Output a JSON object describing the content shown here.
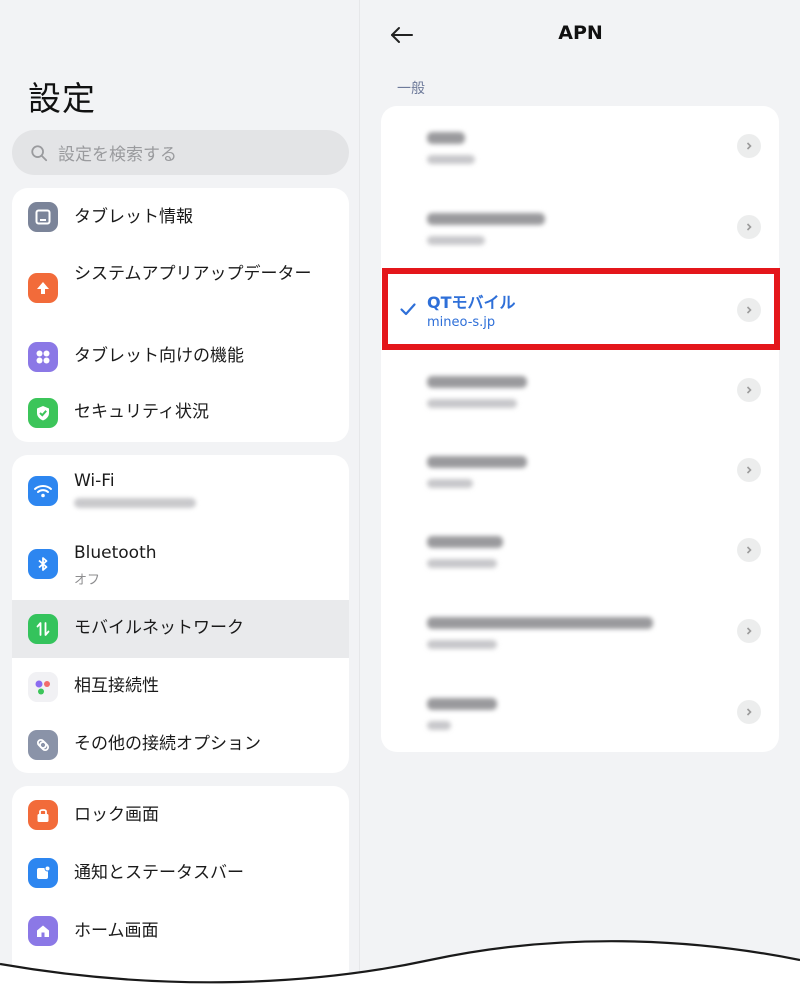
{
  "settings": {
    "title": "設定",
    "search_placeholder": "設定を検索する",
    "groups": [
      {
        "items": [
          {
            "label": "タブレット情報",
            "icon": "tablet-icon",
            "color": "#7b8499"
          },
          {
            "label": "システムアプリアップデーター",
            "icon": "arrow-up-icon",
            "color": "#f26b3a"
          },
          {
            "label": "タブレット向けの機能",
            "icon": "grid-dots-icon",
            "color": "#8b78e6"
          },
          {
            "label": "セキュリティ状況",
            "icon": "shield-check-icon",
            "color": "#3cc55a"
          }
        ]
      },
      {
        "items": [
          {
            "label": "Wi-Fi",
            "sub": "",
            "icon": "wifi-icon",
            "color": "#2d86f0"
          },
          {
            "label": "Bluetooth",
            "sub": "オフ",
            "icon": "bluetooth-icon",
            "color": "#2d86f0"
          },
          {
            "label": "モバイルネットワーク",
            "icon": "mobile-data-icon",
            "color": "#34c35c",
            "selected": true
          },
          {
            "label": "相互接続性",
            "icon": "interconnect-icon",
            "color": "#f1f1f4"
          },
          {
            "label": "その他の接続オプション",
            "icon": "link-icon",
            "color": "#8a93a8"
          }
        ]
      },
      {
        "items": [
          {
            "label": "ロック画面",
            "icon": "lock-icon",
            "color": "#f26b3a"
          },
          {
            "label": "通知とステータスバー",
            "icon": "notification-icon",
            "color": "#2d86f0"
          },
          {
            "label": "ホーム画面",
            "icon": "home-icon",
            "color": "#8b78e6"
          }
        ]
      }
    ]
  },
  "apn": {
    "title": "APN",
    "section": "一般",
    "selected": {
      "name": "QTモバイル",
      "apn": "mineo-s.jp"
    },
    "accent": "#2e6fd8",
    "highlight_color": "#e4161b"
  }
}
